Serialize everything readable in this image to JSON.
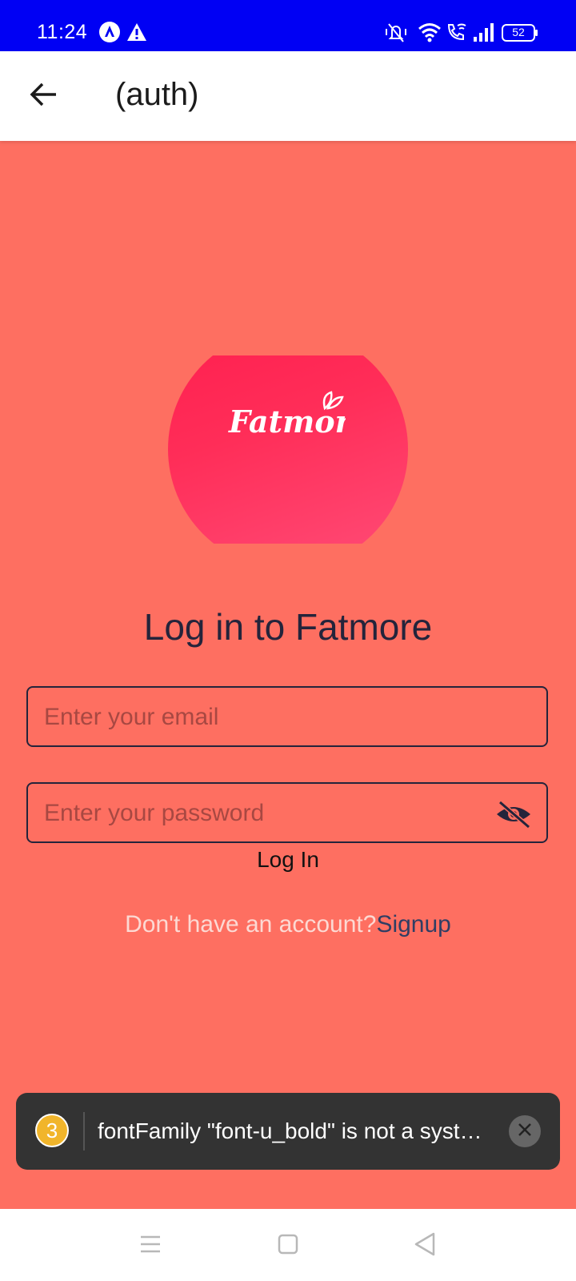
{
  "status_bar": {
    "time": "11:24",
    "battery": "52",
    "icons": [
      "app-notification-icon",
      "warning-icon",
      "vibrate-icon",
      "wifi-icon",
      "wifi-calling-icon",
      "signal-icon",
      "battery-icon"
    ]
  },
  "app_bar": {
    "title": "(auth)",
    "back_icon": "arrow-left-icon"
  },
  "logo": {
    "text": "Fatmore"
  },
  "login": {
    "heading": "Log in to Fatmore",
    "email_placeholder": "Enter your email",
    "email_value": "",
    "password_placeholder": "Enter your password",
    "password_value": "",
    "password_icon": "eye-off-icon",
    "submit_label": "Log In",
    "signup_prompt": "Don't have an account?",
    "signup_link": "Signup"
  },
  "toast": {
    "count": "3",
    "message": "fontFamily \"font-u_bold\" is not a system font and has not been loaded through expo-font.",
    "close_icon": "close-icon"
  },
  "nav_bar": {
    "icons": [
      "menu-icon",
      "home-icon",
      "back-icon"
    ]
  },
  "colors": {
    "status_bar": "#0000f4",
    "background": "#fe6f61",
    "logo_gradient_start": "#ff1f4f",
    "logo_gradient_end": "#ff4c77",
    "text_dark": "#24243b",
    "link": "#2f3e64",
    "toast_bg": "#333333",
    "badge": "#f1b52b"
  }
}
